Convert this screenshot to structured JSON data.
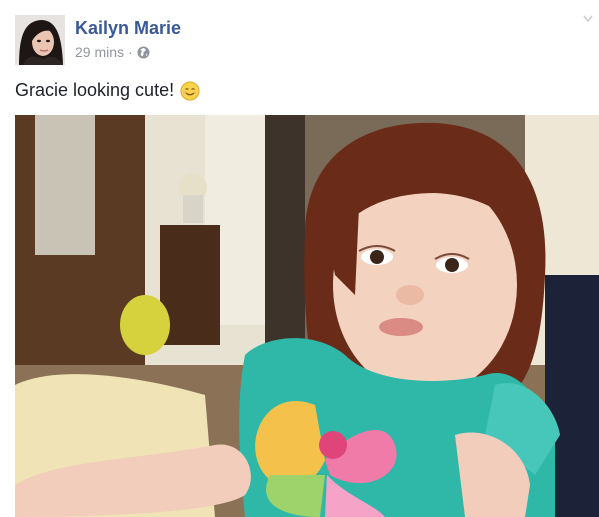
{
  "post": {
    "author": "Kailyn Marie",
    "time": "29 mins",
    "separator": "·",
    "privacy_icon": "globe-icon",
    "text": "Gracie looking cute!",
    "emoji_icon": "smiling-face-icon",
    "menu_icon": "chevron-down-icon"
  },
  "colors": {
    "author_link": "#3b5998",
    "meta_gray": "#90949c",
    "text": "#1d2129"
  }
}
